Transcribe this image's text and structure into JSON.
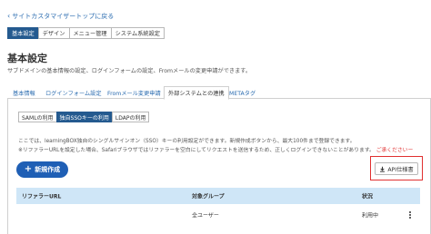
{
  "back_link": {
    "label": "サイトカスタマイザートップに戻る"
  },
  "top_tabs": [
    {
      "label": "基本設定",
      "active": true
    },
    {
      "label": "デザイン",
      "active": false
    },
    {
      "label": "メニュー管理",
      "active": false
    },
    {
      "label": "システム系統設定",
      "active": false
    }
  ],
  "page": {
    "title": "基本設定",
    "description": "サブドメインの基本情報の設定、ログインフォームの設定、Fromメールの変更申請ができます。"
  },
  "sub_tabs": [
    {
      "label": "基本情報",
      "active": false
    },
    {
      "label": "ログインフォーム設定",
      "active": false
    },
    {
      "label": "Fromメール変更申請",
      "active": false
    },
    {
      "label": "外部システムとの連携",
      "active": true
    },
    {
      "label": "METAタグ",
      "active": false
    }
  ],
  "segments": [
    {
      "label": "SAMLの利用",
      "active": false
    },
    {
      "label": "独自SSOキーの利用",
      "active": true
    },
    {
      "label": "LDAPの利用",
      "active": false
    }
  ],
  "info": {
    "line1": "ここでは、learningBOX独自のシングルサインオン（SSO）キーの利用設定ができます。新規作成ボタンから、最大100件まで登録できます。",
    "line2": "※リファラーURLを設定した場合、Safariブラウザではリファラーを空白にしてリクエストを送信するため、正しくログインできないことがあります。",
    "line2_link": "ご承くださいー"
  },
  "new_button": {
    "label": "新規作成",
    "icon": "plus-icon"
  },
  "api_button": {
    "label": "API仕様書",
    "icon": "download-icon"
  },
  "table": {
    "headers": [
      "リファラーURL",
      "対象グループ",
      "状況"
    ],
    "rows": [
      {
        "referrer": "",
        "group": "全ユーザー",
        "status": "利用中"
      }
    ]
  },
  "colors": {
    "primary": "#245a8f",
    "accent_button": "#1f5fb5",
    "highlight_border": "#e03030",
    "table_header": "#cfe6f7"
  }
}
